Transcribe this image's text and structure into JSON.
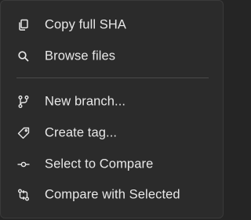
{
  "menu": {
    "items": [
      {
        "label": "Copy full SHA",
        "icon": "copy-icon"
      },
      {
        "label": "Browse files",
        "icon": "search-icon"
      },
      {
        "label": "New branch...",
        "icon": "git-branch-icon"
      },
      {
        "label": "Create tag...",
        "icon": "tag-icon"
      },
      {
        "label": "Select to Compare",
        "icon": "git-commit-icon"
      },
      {
        "label": "Compare with Selected",
        "icon": "git-compare-icon"
      }
    ]
  },
  "colors": {
    "background": "#2b2b2b",
    "text": "#e8e8e8",
    "separator": "#4a4a4a"
  }
}
